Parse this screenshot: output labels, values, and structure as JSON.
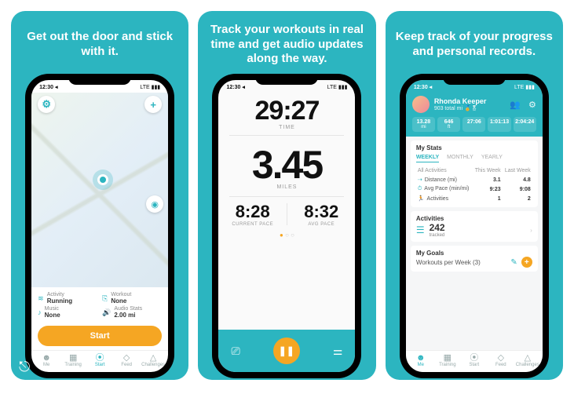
{
  "statusbar": {
    "time": "12:30 ◂",
    "carrier": "LTE ▮▮▮"
  },
  "screen1": {
    "caption": "Get out the door and stick with it.",
    "fields": {
      "activity_label": "Activity",
      "activity_value": "Running",
      "workout_label": "Workout",
      "workout_value": "None",
      "music_label": "Music",
      "music_value": "None",
      "audio_label": "Audio Stats",
      "audio_value": "2.00 mi"
    },
    "start_label": "Start"
  },
  "screen2": {
    "caption": "Track your workouts in real time and get audio updates along the way.",
    "time_value": "29:27",
    "time_label": "TIME",
    "dist_value": "3.45",
    "dist_label": "MILES",
    "curpace_value": "8:28",
    "curpace_label": "CURRENT PACE",
    "avgpace_value": "8:32",
    "avgpace_label": "AVG PACE"
  },
  "screen3": {
    "caption": "Keep track of your progress and personal records.",
    "profile": {
      "name": "Rhonda Keeper",
      "subtitle": "903 total mi 🏅🎖"
    },
    "badges": [
      {
        "v": "13.28",
        "l": "mi"
      },
      {
        "v": "646",
        "l": "ft"
      },
      {
        "v": "27:06",
        "l": ""
      },
      {
        "v": "1:01:13",
        "l": ""
      },
      {
        "v": "2:04:24",
        "l": ""
      }
    ],
    "stats_header": "My Stats",
    "tabs": {
      "weekly": "WEEKLY",
      "monthly": "MONTHLY",
      "yearly": "YEARLY"
    },
    "table": {
      "col0": "All Activities",
      "col1": "This Week",
      "col2": "Last Week",
      "rows": [
        {
          "label": "Distance (mi)",
          "a": "3.1",
          "b": "4.8"
        },
        {
          "label": "Avg Pace (min/mi)",
          "a": "9:23",
          "b": "9:08"
        },
        {
          "label": "Activities",
          "a": "1",
          "b": "2"
        }
      ]
    },
    "activities": {
      "header": "Activities",
      "count": "242",
      "sub": "tracked"
    },
    "goals": {
      "header": "My Goals",
      "row": "Workouts per Week (3)"
    }
  },
  "tabbar": {
    "me": "Me",
    "training": "Training",
    "start": "Start",
    "feed": "Feed",
    "challenges": "Challenges"
  }
}
